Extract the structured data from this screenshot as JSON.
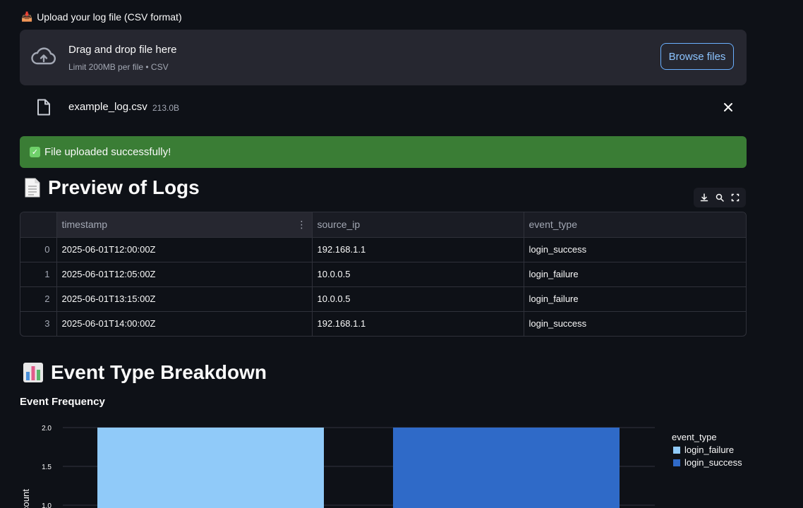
{
  "uploader": {
    "label": "Upload your log file (CSV format)",
    "drop_title": "Drag and drop file here",
    "drop_subtitle": "Limit 200MB per file • CSV",
    "browse_label": "Browse files"
  },
  "file": {
    "name": "example_log.csv",
    "size": "213.0B"
  },
  "alert": {
    "message": "File uploaded successfully!"
  },
  "preview": {
    "title": "Preview of Logs",
    "columns": [
      "timestamp",
      "source_ip",
      "event_type"
    ],
    "rows": [
      {
        "index": "0",
        "timestamp": "2025-06-01T12:00:00Z",
        "source_ip": "192.168.1.1",
        "event_type": "login_success"
      },
      {
        "index": "1",
        "timestamp": "2025-06-01T12:05:00Z",
        "source_ip": "10.0.0.5",
        "event_type": "login_failure"
      },
      {
        "index": "2",
        "timestamp": "2025-06-01T13:15:00Z",
        "source_ip": "10.0.0.5",
        "event_type": "login_failure"
      },
      {
        "index": "3",
        "timestamp": "2025-06-01T14:00:00Z",
        "source_ip": "192.168.1.1",
        "event_type": "login_success"
      }
    ]
  },
  "breakdown": {
    "title": "Event Type Breakdown"
  },
  "chart_data": {
    "type": "bar",
    "title": "Event Frequency",
    "ylabel": "count",
    "categories": [
      "login_failure",
      "login_success"
    ],
    "series": [
      {
        "name": "login_failure",
        "values": [
          2,
          null
        ],
        "color": "#90caf9"
      },
      {
        "name": "login_success",
        "values": [
          null,
          2
        ],
        "color": "#2f6ac8"
      }
    ],
    "yticks": [
      "2.0",
      "1.5",
      "1.0"
    ],
    "legend_title": "event_type",
    "legend_position": "right"
  }
}
